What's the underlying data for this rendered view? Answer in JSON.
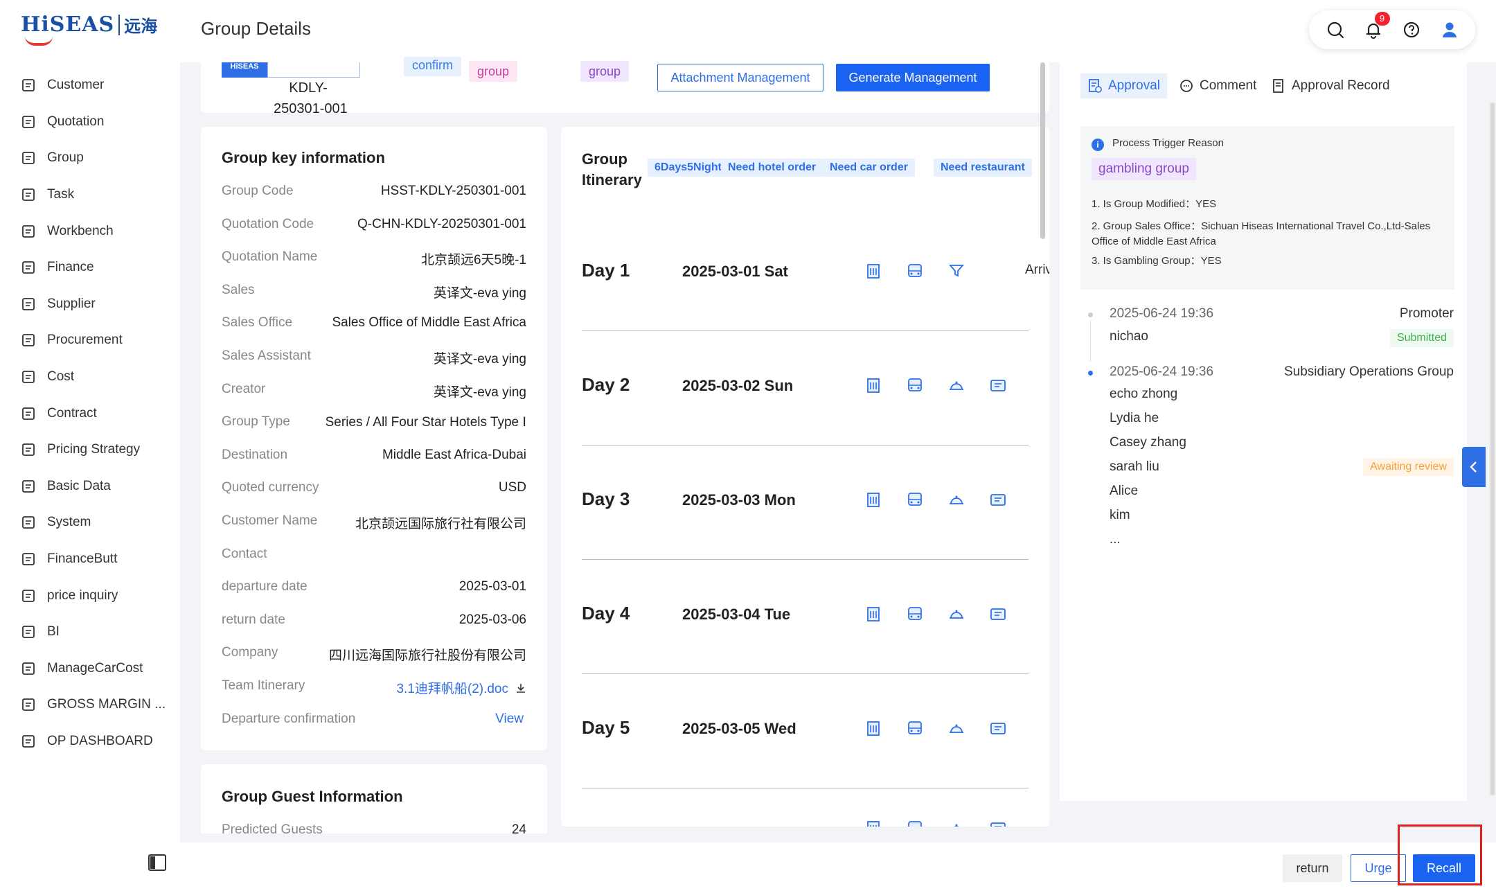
{
  "logo": {
    "brand": "HiSEAS",
    "cn": "远海"
  },
  "sidebar": {
    "items": [
      {
        "label": "Customer",
        "icon": "customer-icon"
      },
      {
        "label": "Quotation",
        "icon": "quotation-icon"
      },
      {
        "label": "Group",
        "icon": "group-icon"
      },
      {
        "label": "Task",
        "icon": "task-icon"
      },
      {
        "label": "Workbench",
        "icon": "workbench-icon"
      },
      {
        "label": "Finance",
        "icon": "finance-icon"
      },
      {
        "label": "Supplier",
        "icon": "supplier-icon"
      },
      {
        "label": "Procurement",
        "icon": "procurement-icon"
      },
      {
        "label": "Cost",
        "icon": "cost-icon"
      },
      {
        "label": "Contract",
        "icon": "contract-icon"
      },
      {
        "label": "Pricing Strategy",
        "icon": "pricing-icon"
      },
      {
        "label": "Basic Data",
        "icon": "basic-data-icon"
      },
      {
        "label": "System",
        "icon": "system-icon"
      },
      {
        "label": "FinanceButt",
        "icon": "finance-butt-icon"
      },
      {
        "label": "price inquiry",
        "icon": "price-inquiry-icon"
      },
      {
        "label": "BI",
        "icon": "bi-icon"
      },
      {
        "label": "ManageCarCost",
        "icon": "manage-car-icon"
      },
      {
        "label": "GROSS MARGIN ...",
        "icon": "gross-margin-icon"
      },
      {
        "label": "OP DASHBOARD",
        "icon": "op-dashboard-icon"
      }
    ]
  },
  "header": {
    "title": "Group Details",
    "notification_count": "9"
  },
  "strip": {
    "code_value": "KDLY-\n250301-001",
    "code_logo": "HiSEAS",
    "tag_confirm": "confirm",
    "tag_group1": "group",
    "tag_group2": "group",
    "attachment_btn": "Attachment Management",
    "generate_btn": "Generate Management"
  },
  "keyinfo": {
    "title": "Group key information",
    "rows": [
      {
        "k": "Group Code",
        "v": "HSST-KDLY-250301-001"
      },
      {
        "k": "Quotation Code",
        "v": "Q-CHN-KDLY-20250301-001"
      },
      {
        "k": "Quotation Name",
        "v": "北京颉远6天5晚-1"
      },
      {
        "k": "Sales",
        "v": "英译文-eva ying"
      },
      {
        "k": "Sales Office",
        "v": "Sales Office of Middle East Africa"
      },
      {
        "k": "Sales Assistant",
        "v": "英译文-eva ying"
      },
      {
        "k": "Creator",
        "v": "英译文-eva ying"
      },
      {
        "k": "Group Type",
        "v": "Series  / All Four Star Hotels Type Ⅰ"
      },
      {
        "k": "Destination",
        "v": "Middle East Africa-Dubai"
      },
      {
        "k": "Quoted currency",
        "v": "USD"
      },
      {
        "k": "Customer Name",
        "v": "北京颉远国际旅行社有限公司"
      },
      {
        "k": "Contact",
        "v": ""
      },
      {
        "k": "departure date",
        "v": "2025-03-01"
      },
      {
        "k": "return date",
        "v": "2025-03-06"
      },
      {
        "k": "Company",
        "v": "四川远海国际旅行社股份有限公司"
      }
    ],
    "team_itinerary_label": "Team Itinerary",
    "team_itinerary_file": "3.1迪拜帆船(2).doc",
    "departure_confirmation_label": "Departure confirmation",
    "departure_confirmation_link": "View"
  },
  "guest": {
    "title": "Group Guest Information",
    "predicted_label": "Predicted Guests",
    "predicted_value": "24"
  },
  "itinerary": {
    "title": "Group\nItinerary",
    "tags": [
      "6Days5Nights",
      "Need hotel order",
      "Need car order",
      "Need restaurant"
    ],
    "days": [
      {
        "label": "Day 1",
        "date": "2025-03-01 Sat",
        "extra": "Arrival C"
      },
      {
        "label": "Day 2",
        "date": "2025-03-02 Sun",
        "extra": ""
      },
      {
        "label": "Day 3",
        "date": "2025-03-03 Mon",
        "extra": ""
      },
      {
        "label": "Day 4",
        "date": "2025-03-04 Tue",
        "extra": ""
      },
      {
        "label": "Day 5",
        "date": "2025-03-05 Wed",
        "extra": ""
      }
    ]
  },
  "approval": {
    "tabs": [
      "Approval",
      "Comment",
      "Approval Record"
    ],
    "reason_title": "Process Trigger Reason",
    "reason_tag": "gambling group",
    "reason_lines": [
      "1. Is Group Modified：YES",
      "2. Group Sales Office：Sichuan Hiseas International Travel Co.,Ltd-Sales Office of Middle East Africa",
      "3. Is Gambling Group：YES"
    ],
    "timeline": [
      {
        "time": "2025-06-24 19:36",
        "role": "Promoter",
        "people": [
          "nichao"
        ],
        "status": "Submitted"
      },
      {
        "time": "2025-06-24 19:36",
        "role": "Subsidiary Operations Group",
        "people": [
          "echo zhong",
          "Lydia he",
          "Casey zhang",
          "sarah liu",
          "Alice",
          "kim",
          "..."
        ],
        "status": "Awaiting review"
      }
    ]
  },
  "footer": {
    "return": "return",
    "urge": "Urge",
    "recall": "Recall"
  },
  "colors": {
    "primary": "#1a62f2",
    "highlight": "#e02020"
  }
}
